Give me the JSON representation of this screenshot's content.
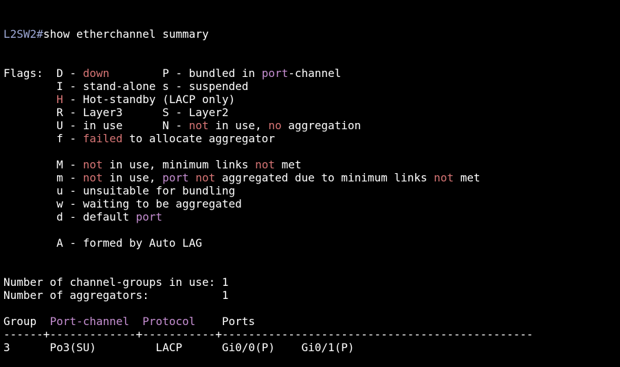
{
  "colors": {
    "background": "#000000",
    "text": "#ffffff",
    "hostname": "#9ea9d7",
    "keyword_red": "#d77575",
    "keyword_purple": "#c58ed1"
  },
  "prompt": {
    "hostname": "L2SW2",
    "symbol": "#",
    "command": "show etherchannel summary"
  },
  "lines": [
    [
      {
        "t": "Flags:  D - "
      },
      {
        "t": "down",
        "c": "red"
      },
      {
        "t": "        P - bundled in "
      },
      {
        "t": "port",
        "c": "purple"
      },
      {
        "t": "-channel"
      }
    ],
    [
      {
        "t": "        I - stand-alone s - suspended"
      }
    ],
    [
      {
        "t": "        "
      },
      {
        "t": "H",
        "c": "red"
      },
      {
        "t": " - Hot-standby (LACP only)"
      }
    ],
    [
      {
        "t": "        R - Layer3      S - Layer2"
      }
    ],
    [
      {
        "t": "        U - in use      N - "
      },
      {
        "t": "not",
        "c": "red"
      },
      {
        "t": " in use, "
      },
      {
        "t": "no",
        "c": "red"
      },
      {
        "t": " aggregation"
      }
    ],
    [
      {
        "t": "        f - "
      },
      {
        "t": "failed",
        "c": "red"
      },
      {
        "t": " to allocate aggregator"
      }
    ],
    [],
    [
      {
        "t": "        M - "
      },
      {
        "t": "not",
        "c": "red"
      },
      {
        "t": " in use, minimum links "
      },
      {
        "t": "not",
        "c": "red"
      },
      {
        "t": " met"
      }
    ],
    [
      {
        "t": "        m - "
      },
      {
        "t": "not",
        "c": "red"
      },
      {
        "t": " in use, "
      },
      {
        "t": "port",
        "c": "purple"
      },
      {
        "t": " "
      },
      {
        "t": "not",
        "c": "red"
      },
      {
        "t": " aggregated due to minimum links "
      },
      {
        "t": "not",
        "c": "red"
      },
      {
        "t": " met"
      }
    ],
    [
      {
        "t": "        u - unsuitable for bundling"
      }
    ],
    [
      {
        "t": "        w - waiting to be aggregated"
      }
    ],
    [
      {
        "t": "        d - default "
      },
      {
        "t": "port",
        "c": "purple"
      }
    ],
    [],
    [
      {
        "t": "        A - formed by Auto LAG"
      }
    ],
    [],
    [],
    [
      {
        "t": "Number of channel-groups in use: 1"
      }
    ],
    [
      {
        "t": "Number of aggregators:           1"
      }
    ],
    [],
    [
      {
        "t": "Group  "
      },
      {
        "t": "Port-channel",
        "c": "purple"
      },
      {
        "t": "  "
      },
      {
        "t": "Protocol",
        "c": "purple"
      },
      {
        "t": "    Ports"
      }
    ],
    [
      {
        "t": "------+-------------+-----------+-----------------------------------------------"
      }
    ],
    [
      {
        "t": "3      Po3(SU)         LACP      Gi0/0(P)    Gi0/1(P)"
      }
    ]
  ]
}
